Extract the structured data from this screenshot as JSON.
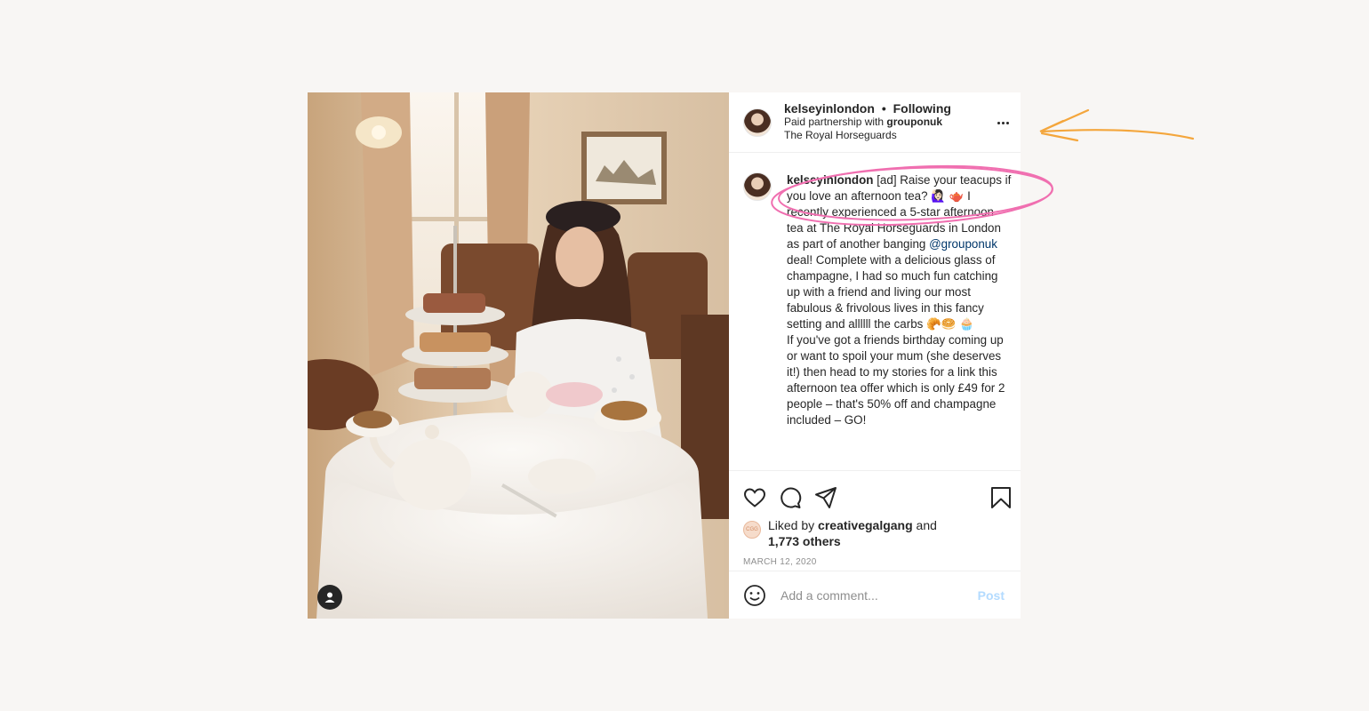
{
  "post": {
    "header": {
      "username": "kelseyinlondon",
      "separator": "•",
      "follow_status": "Following",
      "partnership_prefix": "Paid partnership with",
      "partner": "grouponuk",
      "location": "The Royal Horseguards"
    },
    "caption": {
      "username": "kelseyinlondon",
      "text_part1": " [ad] Raise your teacups if you love an afternoon tea? 🙋🏻‍♀️ 🫖 I recently experienced a 5-star afternoon tea at The Royal Horseguards in London as part of another banging ",
      "mention": "@grouponuk",
      "text_part2": " deal! Complete with a delicious glass of champagne, I had so much fun catching up with a friend and living our most fabulous & frivolous lives in this fancy setting and allllll the carbs 🥐🥯 🧁",
      "paragraph2": " If you've got a friends birthday coming up or want to spoil your mum (she deserves it!) then head to my stories for a link this afternoon tea offer which is only £49 for 2 people – that's 50% off and champagne included – GO!"
    },
    "actions": {
      "like_icon": "heart-icon",
      "comment_icon": "comment-icon",
      "share_icon": "paper-plane-icon",
      "save_icon": "bookmark-icon"
    },
    "likes": {
      "prefix": "Liked by",
      "liker": "creativegalgang",
      "and": "and",
      "others": "1,773 others",
      "liker_avatar_text": "CGG"
    },
    "date": "MARCH 12, 2020",
    "comment": {
      "placeholder": "Add a comment...",
      "post_label": "Post",
      "emoji_icon": "smiley-icon"
    },
    "photo": {
      "user_tag_icon": "person-icon"
    }
  },
  "colors": {
    "background": "#f8f6f4",
    "mention": "#00376b",
    "post_button_disabled": "#b3dbff",
    "annotation_arrow": "#f4a63c",
    "annotation_circle": "#f06fb0"
  }
}
